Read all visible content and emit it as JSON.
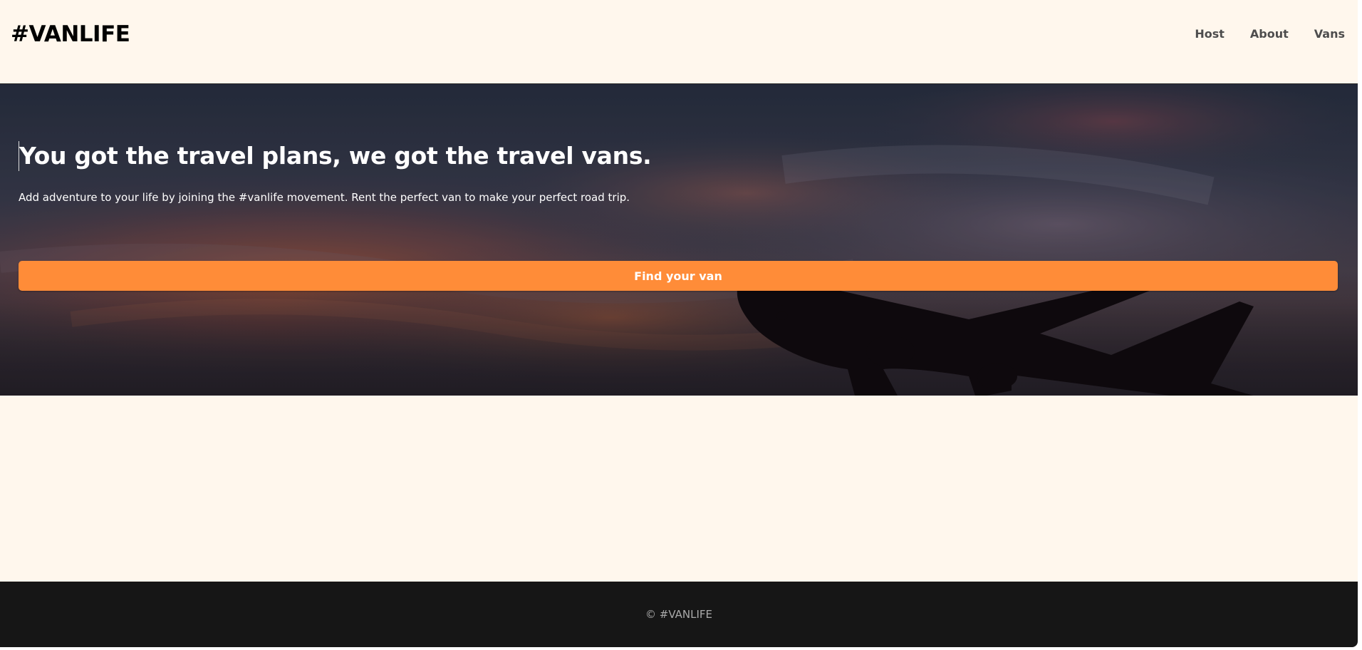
{
  "header": {
    "logo": "#VANLIFE",
    "nav": [
      {
        "label": "Host"
      },
      {
        "label": "About"
      },
      {
        "label": "Vans"
      }
    ]
  },
  "hero": {
    "title": "You got the travel plans, we got the travel vans.",
    "subtitle": "Add adventure to your life by joining the #vanlife movement. Rent the perfect van to make your perfect road trip.",
    "cta_label": "Find your van",
    "image_subject": "airplane-silhouette-sunset-sky"
  },
  "footer": {
    "text": "© #VANLIFE"
  },
  "colors": {
    "page_bg": "#fff7ed",
    "accent": "#ff8c38",
    "footer_bg": "#161616",
    "nav_text": "#4d4d4d"
  }
}
